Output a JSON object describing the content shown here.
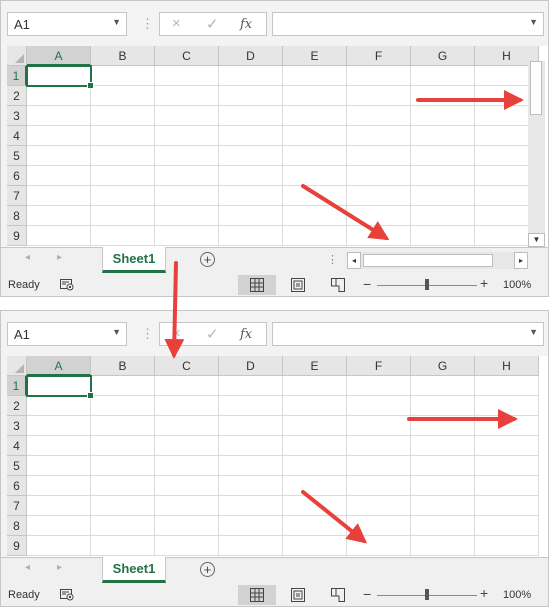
{
  "panels": [
    {
      "id": "top",
      "name_box": "A1",
      "formula_value": "",
      "columns": [
        "A",
        "B",
        "C",
        "D",
        "E",
        "F",
        "G",
        "H"
      ],
      "rows": [
        "1",
        "2",
        "3",
        "4",
        "5",
        "6",
        "7",
        "8",
        "9"
      ],
      "sheet_tab": "Sheet1",
      "status": "Ready",
      "zoom": "100%",
      "has_scrollbars": true
    },
    {
      "id": "bottom",
      "name_box": "A1",
      "formula_value": "",
      "columns": [
        "A",
        "B",
        "C",
        "D",
        "E",
        "F",
        "G",
        "H"
      ],
      "rows": [
        "1",
        "2",
        "3",
        "4",
        "5",
        "6",
        "7",
        "8",
        "9"
      ],
      "sheet_tab": "Sheet1",
      "status": "Ready",
      "zoom": "100%",
      "has_scrollbars": false
    }
  ],
  "icons": {
    "formula_cancel": "×",
    "formula_enter": "✓",
    "formula_fx": "fx",
    "add_sheet": "+",
    "zoom_minus": "−",
    "zoom_plus": "+",
    "dropdown": "▼",
    "tab_prev": "◂",
    "tab_next": "▸",
    "scroll_down": "▼",
    "scroll_left": "◂",
    "scroll_right": "▸"
  },
  "colors": {
    "accent": "#217346",
    "annotation_arrow": "#e8403a"
  }
}
